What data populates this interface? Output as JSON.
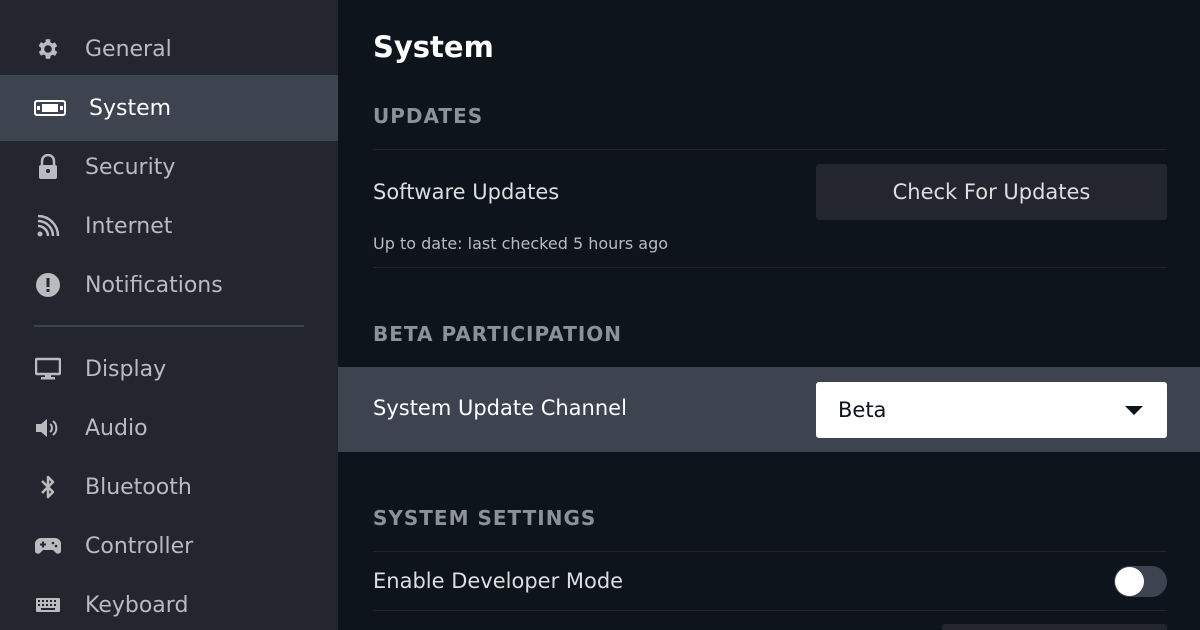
{
  "sidebar": {
    "items": [
      {
        "label": "General",
        "icon": "gear-icon"
      },
      {
        "label": "System",
        "icon": "handheld-icon",
        "active": true
      },
      {
        "label": "Security",
        "icon": "lock-icon"
      },
      {
        "label": "Internet",
        "icon": "wifi-icon"
      },
      {
        "label": "Notifications",
        "icon": "exclamation-circle-icon"
      },
      {
        "label": "Display",
        "icon": "monitor-icon"
      },
      {
        "label": "Audio",
        "icon": "speaker-icon"
      },
      {
        "label": "Bluetooth",
        "icon": "bluetooth-icon"
      },
      {
        "label": "Controller",
        "icon": "gamepad-icon"
      },
      {
        "label": "Keyboard",
        "icon": "keyboard-icon"
      }
    ]
  },
  "main": {
    "title": "System",
    "updates": {
      "header": "UPDATES",
      "software_updates_label": "Software Updates",
      "status": "Up to date: last checked 5 hours ago",
      "check_button_label": "Check For Updates"
    },
    "beta": {
      "header": "BETA PARTICIPATION",
      "channel_label": "System Update Channel",
      "channel_value": "Beta"
    },
    "system_settings": {
      "header": "SYSTEM SETTINGS",
      "developer_mode_label": "Enable Developer Mode",
      "developer_mode_enabled": false
    }
  },
  "colors": {
    "background": "#0e141b",
    "sidebar": "#23262e",
    "highlight": "#3d4450",
    "text_primary": "#ffffff",
    "text_secondary": "#b8bcbf",
    "section_header": "#8b929a"
  }
}
